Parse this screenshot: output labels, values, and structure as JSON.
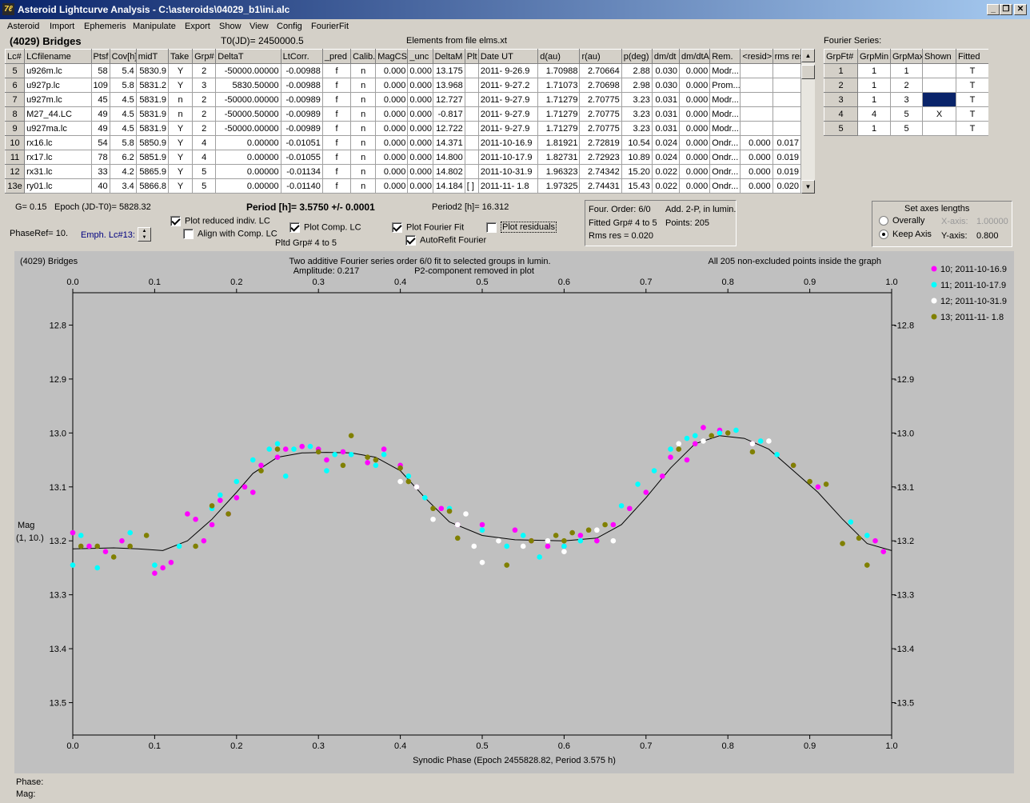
{
  "window": {
    "title": "Asteroid Lightcurve Analysis - C:\\asteroids\\04029_b1\\ini.alc"
  },
  "menu": [
    "Asteroid",
    "Import",
    "Ephemeris",
    "Manipulate",
    "Export",
    "Show",
    "View",
    "Config",
    "FourierFit"
  ],
  "header": {
    "asteroid": "(4029) Bridges",
    "t0": "T0(JD)= 2450000.5",
    "elements": "Elements from file elms.xt"
  },
  "lc_table": {
    "columns": [
      "Lc#",
      "LCfilename",
      "Ptsf",
      "Cov[h]",
      "midT",
      "Take",
      "Grp#",
      "DeltaT",
      "LtCorr.",
      "_pred",
      "Calib.",
      "MagCS",
      "_unc",
      "DeltaM",
      "Plt",
      "Date UT",
      "d(au)",
      "r(au)",
      "p(deg)",
      "dm/dt",
      "dm/dtA",
      "Rem.",
      "<resid>",
      "rms res"
    ],
    "rows": [
      [
        "5",
        "u926m.lc",
        "58",
        "5.4",
        "5830.9",
        "Y",
        "2",
        "-50000.00000",
        "-0.00988",
        "f",
        "n",
        "0.000",
        "0.000",
        "13.175",
        "",
        "2011- 9-26.9",
        "1.70988",
        "2.70664",
        "2.88",
        "0.030",
        "0.000",
        "Modr...",
        "",
        ""
      ],
      [
        "6",
        "u927p.lc",
        "109",
        "5.8",
        "5831.2",
        "Y",
        "3",
        "5830.50000",
        "-0.00988",
        "f",
        "n",
        "0.000",
        "0.000",
        "13.968",
        "",
        "2011- 9-27.2",
        "1.71073",
        "2.70698",
        "2.98",
        "0.030",
        "0.000",
        "Prom...",
        "",
        ""
      ],
      [
        "7",
        "u927m.lc",
        "45",
        "4.5",
        "5831.9",
        "n",
        "2",
        "-50000.00000",
        "-0.00989",
        "f",
        "n",
        "0.000",
        "0.000",
        "12.727",
        "",
        "2011- 9-27.9",
        "1.71279",
        "2.70775",
        "3.23",
        "0.031",
        "0.000",
        "Modr...",
        "",
        ""
      ],
      [
        "8",
        "M27_44.LC",
        "49",
        "4.5",
        "5831.9",
        "n",
        "2",
        "-50000.50000",
        "-0.00989",
        "f",
        "n",
        "0.000",
        "0.000",
        "-0.817",
        "",
        "2011- 9-27.9",
        "1.71279",
        "2.70775",
        "3.23",
        "0.031",
        "0.000",
        "Modr...",
        "",
        ""
      ],
      [
        "9",
        "u927ma.lc",
        "49",
        "4.5",
        "5831.9",
        "Y",
        "2",
        "-50000.00000",
        "-0.00989",
        "f",
        "n",
        "0.000",
        "0.000",
        "12.722",
        "",
        "2011- 9-27.9",
        "1.71279",
        "2.70775",
        "3.23",
        "0.031",
        "0.000",
        "Modr...",
        "",
        ""
      ],
      [
        "10",
        "rx16.lc",
        "54",
        "5.8",
        "5850.9",
        "Y",
        "4",
        "0.00000",
        "-0.01051",
        "f",
        "n",
        "0.000",
        "0.000",
        "14.371",
        "",
        "2011-10-16.9",
        "1.81921",
        "2.72819",
        "10.54",
        "0.024",
        "0.000",
        "Ondr...",
        "0.000",
        "0.017"
      ],
      [
        "11",
        "rx17.lc",
        "78",
        "6.2",
        "5851.9",
        "Y",
        "4",
        "0.00000",
        "-0.01055",
        "f",
        "n",
        "0.000",
        "0.000",
        "14.800",
        "",
        "2011-10-17.9",
        "1.82731",
        "2.72923",
        "10.89",
        "0.024",
        "0.000",
        "Ondr...",
        "0.000",
        "0.019"
      ],
      [
        "12",
        "rx31.lc",
        "33",
        "4.2",
        "5865.9",
        "Y",
        "5",
        "0.00000",
        "-0.01134",
        "f",
        "n",
        "0.000",
        "0.000",
        "14.802",
        "",
        "2011-10-31.9",
        "1.96323",
        "2.74342",
        "15.20",
        "0.022",
        "0.000",
        "Ondr...",
        "0.000",
        "0.019"
      ],
      [
        "13e",
        "ry01.lc",
        "40",
        "3.4",
        "5866.8",
        "Y",
        "5",
        "0.00000",
        "-0.01140",
        "f",
        "n",
        "0.000",
        "0.000",
        "14.184",
        "[ ]",
        "2011-11- 1.8",
        "1.97325",
        "2.74431",
        "15.43",
        "0.022",
        "0.000",
        "Ondr...",
        "0.000",
        "0.020"
      ]
    ]
  },
  "fourier": {
    "title": "Fourier Series:",
    "columns": [
      "GrpFt#",
      "GrpMin",
      "GrpMax",
      "Shown",
      "Fitted"
    ],
    "rows": [
      [
        "1",
        "1",
        "1",
        "",
        "T"
      ],
      [
        "2",
        "1",
        "2",
        "",
        "T"
      ],
      [
        "3",
        "1",
        "3",
        "",
        "T"
      ],
      [
        "4",
        "4",
        "5",
        "X",
        "T"
      ],
      [
        "5",
        "1",
        "5",
        "",
        "T"
      ]
    ]
  },
  "controls": {
    "g": "G= 0.15",
    "epoch": "Epoch (JD-T0)= 5828.32",
    "phase_ref": "PhaseRef= 10.",
    "emph": "Emph. Lc#13:",
    "period": "Period [h]= 3.5750 +/- 0.0001",
    "period2": "Period2 [h]= 16.312",
    "plot_reduced": "Plot reduced indiv. LC",
    "align_comp": "Align with Comp. LC",
    "plot_comp": "Plot Comp. LC",
    "pltd_grp": "Pltd Grp#  4   to   5",
    "plot_fourier": "Plot Fourier Fit",
    "autorefit": "AutoRefit Fourier",
    "plot_residuals": "Plot residuals"
  },
  "info": {
    "four_order": "Four. Order:  6/0",
    "add": "Add. 2-P, in lumin.",
    "fitted": "Fitted Grp# 4 to 5",
    "points": "Points: 205",
    "rms": "Rms res      = 0.020"
  },
  "axes": {
    "title": "Set axes lengths",
    "overally": "Overally",
    "keep": "Keep Axis",
    "xaxis_label": "X-axis:",
    "xaxis_value": "1.00000",
    "yaxis_label": "Y-axis:",
    "yaxis_value": "0.800"
  },
  "plot": {
    "name": "(4029) Bridges",
    "line1": "Two additive Fourier series order 6/0 fit to selected groups in lumin.",
    "amplitude": "Amplitude: 0.217",
    "p2": "P2-component removed in plot",
    "all": "All 205 non-excluded points inside the graph",
    "ylabel1": "Mag",
    "ylabel2": "(1, 10.)",
    "xlabel": "Synodic Phase (Epoch 2455828.82, Period 3.575 h)"
  },
  "chart_data": {
    "type": "scatter",
    "xlim": [
      0,
      1
    ],
    "ylim": [
      12.74,
      13.56
    ],
    "y_inverted": true,
    "xticks": [
      "0.0",
      "0.1",
      "0.2",
      "0.3",
      "0.4",
      "0.5",
      "0.6",
      "0.7",
      "0.8",
      "0.9",
      "1.0"
    ],
    "yticks": [
      "12.8",
      "12.9",
      "13.0",
      "13.1",
      "13.2",
      "13.3",
      "13.4",
      "13.5"
    ],
    "legend": [
      {
        "name": "10; 2011-10-16.9",
        "color": "#ff00ff"
      },
      {
        "name": "11; 2011-10-17.9",
        "color": "#00ffff"
      },
      {
        "name": "12; 2011-10-31.9",
        "color": "#ffffff"
      },
      {
        "name": "13; 2011-11- 1.8",
        "color": "#808000"
      }
    ],
    "series": [
      {
        "name": "10; 2011-10-16.9",
        "color": "#ff00ff",
        "points": [
          [
            0.0,
            13.185
          ],
          [
            0.02,
            13.21
          ],
          [
            0.04,
            13.22
          ],
          [
            0.06,
            13.2
          ],
          [
            0.1,
            13.26
          ],
          [
            0.11,
            13.25
          ],
          [
            0.12,
            13.24
          ],
          [
            0.14,
            13.15
          ],
          [
            0.15,
            13.16
          ],
          [
            0.16,
            13.2
          ],
          [
            0.17,
            13.17
          ],
          [
            0.18,
            13.125
          ],
          [
            0.19,
            13.15
          ],
          [
            0.2,
            13.12
          ],
          [
            0.21,
            13.1
          ],
          [
            0.22,
            13.11
          ],
          [
            0.23,
            13.06
          ],
          [
            0.25,
            13.045
          ],
          [
            0.26,
            13.03
          ],
          [
            0.28,
            13.025
          ],
          [
            0.3,
            13.03
          ],
          [
            0.31,
            13.05
          ],
          [
            0.33,
            13.035
          ],
          [
            0.36,
            13.055
          ],
          [
            0.38,
            13.03
          ],
          [
            0.4,
            13.06
          ],
          [
            0.42,
            13.1
          ],
          [
            0.45,
            13.14
          ],
          [
            0.47,
            13.17
          ],
          [
            0.5,
            13.17
          ],
          [
            0.54,
            13.18
          ],
          [
            0.56,
            13.2
          ],
          [
            0.58,
            13.21
          ],
          [
            0.6,
            13.21
          ],
          [
            0.62,
            13.19
          ],
          [
            0.64,
            13.2
          ],
          [
            0.66,
            13.17
          ],
          [
            0.68,
            13.14
          ],
          [
            0.7,
            13.11
          ],
          [
            0.72,
            13.08
          ],
          [
            0.73,
            13.045
          ],
          [
            0.75,
            13.05
          ],
          [
            0.76,
            13.02
          ],
          [
            0.77,
            12.99
          ],
          [
            0.79,
            12.995
          ],
          [
            0.83,
            13.02
          ],
          [
            0.88,
            13.06
          ],
          [
            0.91,
            13.1
          ],
          [
            0.98,
            13.2
          ],
          [
            0.99,
            13.22
          ]
        ]
      },
      {
        "name": "11; 2011-10-17.9",
        "color": "#00ffff",
        "points": [
          [
            0.0,
            13.245
          ],
          [
            0.01,
            13.19
          ],
          [
            0.03,
            13.25
          ],
          [
            0.07,
            13.185
          ],
          [
            0.1,
            13.245
          ],
          [
            0.13,
            13.21
          ],
          [
            0.17,
            13.14
          ],
          [
            0.18,
            13.115
          ],
          [
            0.2,
            13.09
          ],
          [
            0.22,
            13.05
          ],
          [
            0.24,
            13.03
          ],
          [
            0.25,
            13.02
          ],
          [
            0.26,
            13.08
          ],
          [
            0.27,
            13.03
          ],
          [
            0.29,
            13.025
          ],
          [
            0.31,
            13.07
          ],
          [
            0.32,
            13.04
          ],
          [
            0.34,
            13.04
          ],
          [
            0.37,
            13.06
          ],
          [
            0.38,
            13.04
          ],
          [
            0.41,
            13.08
          ],
          [
            0.43,
            13.12
          ],
          [
            0.46,
            13.14
          ],
          [
            0.5,
            13.18
          ],
          [
            0.53,
            13.21
          ],
          [
            0.55,
            13.19
          ],
          [
            0.57,
            13.23
          ],
          [
            0.6,
            13.21
          ],
          [
            0.62,
            13.2
          ],
          [
            0.67,
            13.135
          ],
          [
            0.69,
            13.095
          ],
          [
            0.71,
            13.07
          ],
          [
            0.73,
            13.03
          ],
          [
            0.75,
            13.01
          ],
          [
            0.76,
            13.005
          ],
          [
            0.79,
            13.0
          ],
          [
            0.81,
            12.995
          ],
          [
            0.84,
            13.015
          ],
          [
            0.86,
            13.04
          ],
          [
            0.95,
            13.165
          ],
          [
            0.97,
            13.19
          ]
        ]
      },
      {
        "name": "12; 2011-10-31.9",
        "color": "#ffffff",
        "points": [
          [
            0.4,
            13.09
          ],
          [
            0.42,
            13.1
          ],
          [
            0.44,
            13.16
          ],
          [
            0.47,
            13.17
          ],
          [
            0.48,
            13.15
          ],
          [
            0.49,
            13.21
          ],
          [
            0.5,
            13.24
          ],
          [
            0.52,
            13.2
          ],
          [
            0.55,
            13.21
          ],
          [
            0.58,
            13.2
          ],
          [
            0.6,
            13.22
          ],
          [
            0.64,
            13.18
          ],
          [
            0.66,
            13.2
          ],
          [
            0.74,
            13.02
          ],
          [
            0.77,
            13.015
          ],
          [
            0.78,
            13.005
          ],
          [
            0.8,
            13.0
          ],
          [
            0.83,
            13.02
          ],
          [
            0.85,
            13.015
          ]
        ]
      },
      {
        "name": "13; 2011-11- 1.8",
        "color": "#808000",
        "points": [
          [
            0.01,
            13.21
          ],
          [
            0.03,
            13.21
          ],
          [
            0.05,
            13.23
          ],
          [
            0.07,
            13.21
          ],
          [
            0.09,
            13.19
          ],
          [
            0.15,
            13.21
          ],
          [
            0.17,
            13.135
          ],
          [
            0.19,
            13.15
          ],
          [
            0.23,
            13.07
          ],
          [
            0.25,
            13.03
          ],
          [
            0.3,
            13.035
          ],
          [
            0.33,
            13.06
          ],
          [
            0.34,
            13.005
          ],
          [
            0.36,
            13.045
          ],
          [
            0.37,
            13.05
          ],
          [
            0.4,
            13.065
          ],
          [
            0.41,
            13.09
          ],
          [
            0.44,
            13.14
          ],
          [
            0.46,
            13.145
          ],
          [
            0.47,
            13.195
          ],
          [
            0.53,
            13.245
          ],
          [
            0.56,
            13.2
          ],
          [
            0.59,
            13.19
          ],
          [
            0.6,
            13.2
          ],
          [
            0.61,
            13.185
          ],
          [
            0.63,
            13.18
          ],
          [
            0.65,
            13.17
          ],
          [
            0.74,
            13.03
          ],
          [
            0.78,
            13.005
          ],
          [
            0.8,
            13.0
          ],
          [
            0.83,
            13.035
          ],
          [
            0.88,
            13.06
          ],
          [
            0.9,
            13.09
          ],
          [
            0.92,
            13.095
          ],
          [
            0.94,
            13.205
          ],
          [
            0.96,
            13.195
          ],
          [
            0.97,
            13.245
          ]
        ]
      }
    ],
    "fit_curve": [
      [
        0.0,
        13.215
      ],
      [
        0.05,
        13.213
      ],
      [
        0.08,
        13.215
      ],
      [
        0.11,
        13.218
      ],
      [
        0.14,
        13.2
      ],
      [
        0.17,
        13.16
      ],
      [
        0.2,
        13.11
      ],
      [
        0.22,
        13.075
      ],
      [
        0.25,
        13.045
      ],
      [
        0.28,
        13.037
      ],
      [
        0.31,
        13.036
      ],
      [
        0.34,
        13.037
      ],
      [
        0.37,
        13.045
      ],
      [
        0.4,
        13.07
      ],
      [
        0.43,
        13.12
      ],
      [
        0.46,
        13.165
      ],
      [
        0.5,
        13.19
      ],
      [
        0.54,
        13.198
      ],
      [
        0.6,
        13.2
      ],
      [
        0.64,
        13.195
      ],
      [
        0.67,
        13.17
      ],
      [
        0.7,
        13.12
      ],
      [
        0.73,
        13.065
      ],
      [
        0.76,
        13.02
      ],
      [
        0.79,
        13.005
      ],
      [
        0.82,
        13.01
      ],
      [
        0.85,
        13.03
      ],
      [
        0.88,
        13.07
      ],
      [
        0.91,
        13.11
      ],
      [
        0.94,
        13.16
      ],
      [
        0.97,
        13.205
      ],
      [
        1.0,
        13.218
      ]
    ]
  }
}
